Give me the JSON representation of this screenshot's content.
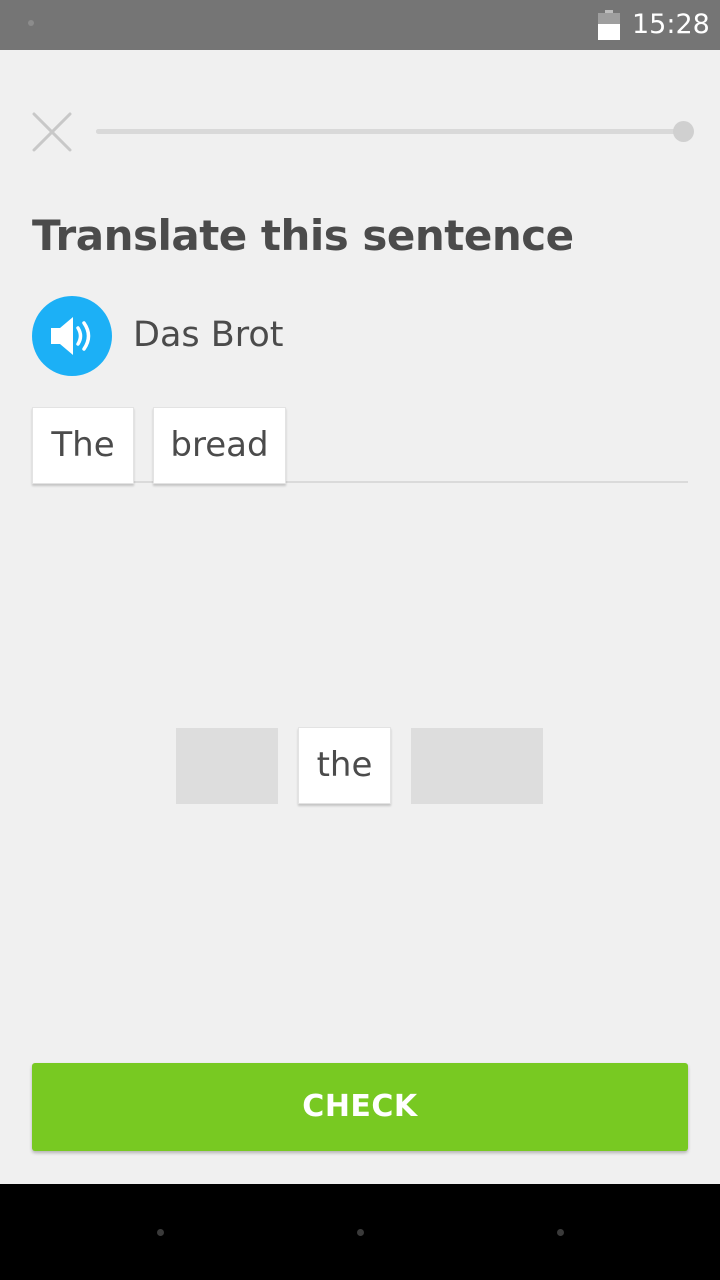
{
  "status_bar": {
    "time": "15:28",
    "battery_level": 0.6,
    "notification_icon": "dot-icon"
  },
  "header": {
    "close_icon": "close-icon",
    "progress": 1.0
  },
  "exercise": {
    "title": "Translate this sentence",
    "speaker_icon": "speaker-icon",
    "prompt": "Das Brot"
  },
  "answer": {
    "tiles": [
      "The",
      "bread"
    ]
  },
  "word_bank": {
    "tiles": [
      {
        "label": "",
        "used": true
      },
      {
        "label": "the",
        "used": false
      },
      {
        "label": "",
        "used": true
      }
    ]
  },
  "actions": {
    "check_label": "CHECK",
    "accent_color": "#78c922"
  },
  "navigation": {
    "buttons": [
      "back-icon",
      "home-icon",
      "recents-icon"
    ]
  },
  "colors": {
    "speaker_blue": "#1cb0f6",
    "title_text": "#4b4b4b",
    "background": "#f0f0f0"
  }
}
